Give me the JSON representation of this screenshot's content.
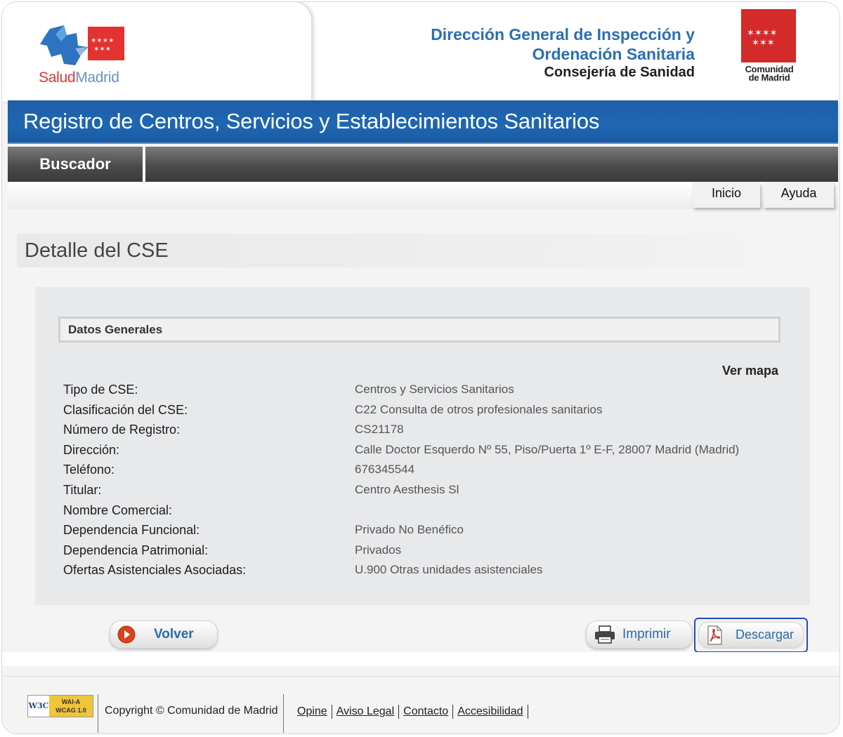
{
  "header": {
    "logo_salud": "Salud",
    "logo_madrid": "Madrid",
    "org_line1": "Dirección General de Inspección y",
    "org_line2": "Ordenación Sanitaria",
    "org_sub": "Consejería de Sanidad",
    "cm_line1": "Comunidad",
    "cm_line2": "de Madrid"
  },
  "banner": {
    "title": "Registro de Centros, Servicios y Establecimientos Sanitarios"
  },
  "nav": {
    "buscador": "Buscador",
    "inicio": "Inicio",
    "ayuda": "Ayuda"
  },
  "page": {
    "title": "Detalle del CSE"
  },
  "section": {
    "title": "Datos Generales",
    "ver_mapa": "Ver mapa",
    "rows": [
      {
        "label": "Tipo de CSE:",
        "value": "Centros y Servicios Sanitarios"
      },
      {
        "label": "Clasificación del CSE:",
        "value": "C22 Consulta de otros profesionales sanitarios"
      },
      {
        "label": "Número de Registro:",
        "value": "CS21178"
      },
      {
        "label": "Dirección:",
        "value": "Calle Doctor Esquerdo Nº 55, Piso/Puerta 1º E-F, 28007 Madrid (Madrid)"
      },
      {
        "label": "Teléfono:",
        "value": "676345544"
      },
      {
        "label": "Titular:",
        "value": "Centro Aesthesis Sl"
      },
      {
        "label": "Nombre Comercial:",
        "value": ""
      },
      {
        "label": "Dependencia Funcional:",
        "value": "Privado No Benéfico"
      },
      {
        "label": "Dependencia Patrimonial:",
        "value": "Privados"
      },
      {
        "label": "Ofertas Asistenciales Asociadas:",
        "value": "U.900 Otras unidades asistenciales"
      }
    ]
  },
  "buttons": {
    "volver": "Volver",
    "imprimir": "Imprimir",
    "descargar": "Descargar"
  },
  "footer": {
    "w3c": "W3C",
    "wai_line1": "WAI-A",
    "wai_line2": "WCAG 1.0",
    "copyright": "Copyright © Comunidad de Madrid",
    "links": [
      "Opine",
      "Aviso Legal",
      "Contacto",
      "Accesibilidad"
    ]
  },
  "colors": {
    "banner_blue": "#1e67b3",
    "org_blue": "#2a6fb1",
    "cm_red": "#d42a2a",
    "button_text": "#2c6aa8",
    "focus_outline": "#1c4fbf"
  }
}
